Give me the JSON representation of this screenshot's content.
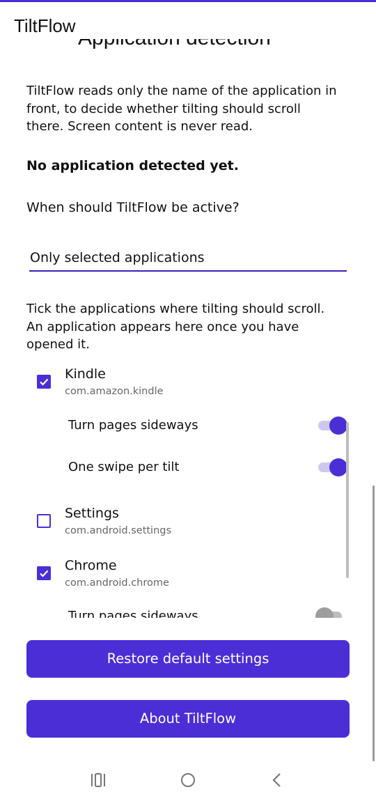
{
  "app": {
    "title": "TiltFlow",
    "accent_color": "#4b2ed6"
  },
  "section": {
    "heading": "Application detection",
    "intro": "TiltFlow reads only the name of the application in front, to decide whether tilting should scroll there. Screen content is never read.",
    "detected_status": "No application detected yet.",
    "active_question": "When should TiltFlow be active?",
    "mode_select_value": "Only selected applications",
    "list_help": "Tick the applications where tilting should scroll. An application appears here once you have opened it."
  },
  "apps": [
    {
      "name": "Kindle",
      "package": "com.amazon.kindle",
      "checked": true,
      "options": [
        {
          "label": "Turn pages sideways",
          "on": true
        },
        {
          "label": "One swipe per tilt",
          "on": true
        }
      ]
    },
    {
      "name": "Settings",
      "package": "com.android.settings",
      "checked": false,
      "options": []
    },
    {
      "name": "Chrome",
      "package": "com.android.chrome",
      "checked": true,
      "options": [
        {
          "label": "Turn pages sideways",
          "on": false
        }
      ]
    }
  ],
  "buttons": {
    "restore": "Restore default settings",
    "about": "About TiltFlow"
  },
  "navbar": {
    "icons": [
      "recent-apps-icon",
      "home-icon",
      "back-icon"
    ]
  }
}
